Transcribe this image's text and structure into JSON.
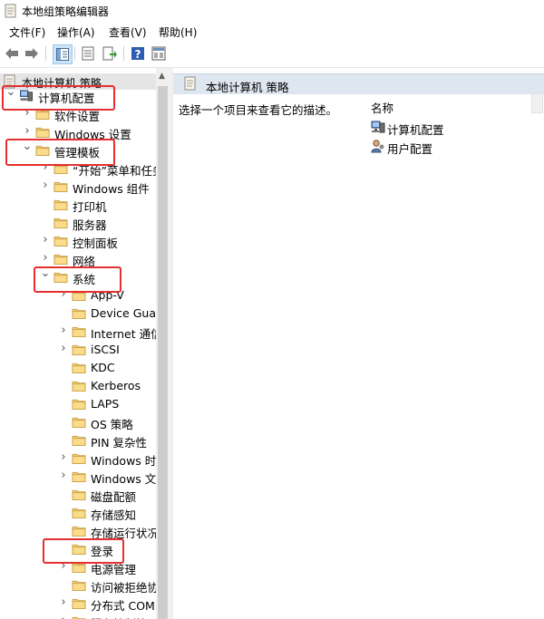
{
  "window": {
    "title": "本地组策略编辑器"
  },
  "menu": [
    "文件(F)",
    "操作(A)",
    "查看(V)",
    "帮助(H)"
  ],
  "toolbar": {
    "buttons": [
      "back-arrow-icon",
      "forward-arrow-icon",
      "show-tree-icon",
      "properties-icon",
      "export-icon",
      "help-icon",
      "filter-pane-icon"
    ]
  },
  "tree": {
    "root": "本地计算机 策略",
    "items": [
      {
        "label": "计算机配置",
        "level": 0,
        "expander": "expanded",
        "icon": "computer-config"
      },
      {
        "label": "软件设置",
        "level": 1,
        "expander": "collapsed",
        "icon": "folder"
      },
      {
        "label": "Windows 设置",
        "level": 1,
        "expander": "collapsed",
        "icon": "folder"
      },
      {
        "label": "管理模板",
        "level": 1,
        "expander": "expanded",
        "icon": "folder"
      },
      {
        "label": "“开始”菜单和任务",
        "level": 2,
        "expander": "collapsed",
        "icon": "folder"
      },
      {
        "label": "Windows 组件",
        "level": 2,
        "expander": "collapsed",
        "icon": "folder"
      },
      {
        "label": "打印机",
        "level": 2,
        "expander": "none",
        "icon": "folder"
      },
      {
        "label": "服务器",
        "level": 2,
        "expander": "none",
        "icon": "folder"
      },
      {
        "label": "控制面板",
        "level": 2,
        "expander": "collapsed",
        "icon": "folder"
      },
      {
        "label": "网络",
        "level": 2,
        "expander": "collapsed",
        "icon": "folder"
      },
      {
        "label": "系统",
        "level": 2,
        "expander": "expanded",
        "icon": "folder"
      },
      {
        "label": "App-V",
        "level": 3,
        "expander": "collapsed",
        "icon": "folder"
      },
      {
        "label": "Device Guard",
        "level": 3,
        "expander": "none",
        "icon": "folder"
      },
      {
        "label": "Internet 通信",
        "level": 3,
        "expander": "collapsed",
        "icon": "folder"
      },
      {
        "label": "iSCSI",
        "level": 3,
        "expander": "collapsed",
        "icon": "folder"
      },
      {
        "label": "KDC",
        "level": 3,
        "expander": "none",
        "icon": "folder"
      },
      {
        "label": "Kerberos",
        "level": 3,
        "expander": "none",
        "icon": "folder"
      },
      {
        "label": "LAPS",
        "level": 3,
        "expander": "none",
        "icon": "folder"
      },
      {
        "label": "OS 策略",
        "level": 3,
        "expander": "none",
        "icon": "folder"
      },
      {
        "label": "PIN 复杂性",
        "level": 3,
        "expander": "none",
        "icon": "folder"
      },
      {
        "label": "Windows 时",
        "level": 3,
        "expander": "collapsed",
        "icon": "folder"
      },
      {
        "label": "Windows 文",
        "level": 3,
        "expander": "collapsed",
        "icon": "folder"
      },
      {
        "label": "磁盘配额",
        "level": 3,
        "expander": "none",
        "icon": "folder"
      },
      {
        "label": "存储感知",
        "level": 3,
        "expander": "none",
        "icon": "folder"
      },
      {
        "label": "存储运行状况",
        "level": 3,
        "expander": "none",
        "icon": "folder"
      },
      {
        "label": "登录",
        "level": 3,
        "expander": "none",
        "icon": "folder"
      },
      {
        "label": "电源管理",
        "level": 3,
        "expander": "collapsed",
        "icon": "folder"
      },
      {
        "label": "访问被拒绝协",
        "level": 3,
        "expander": "none",
        "icon": "folder"
      },
      {
        "label": "分布式 COM",
        "level": 3,
        "expander": "collapsed",
        "icon": "folder"
      },
      {
        "label": "服务控制管理",
        "level": 3,
        "expander": "collapsed",
        "icon": "folder"
      }
    ]
  },
  "right": {
    "header": "本地计算机 策略",
    "description": "选择一个项目来查看它的描述。",
    "column_name": "名称",
    "items": [
      {
        "label": "计算机配置",
        "icon": "computer-config"
      },
      {
        "label": "用户配置",
        "icon": "user-config"
      }
    ]
  },
  "highlights": [
    "计算机配置",
    "管理模板",
    "系统",
    "登录"
  ],
  "colors": {
    "highlight": "#e53030",
    "folder": "#f6cd6b",
    "header_bg": "#dee6f0"
  }
}
